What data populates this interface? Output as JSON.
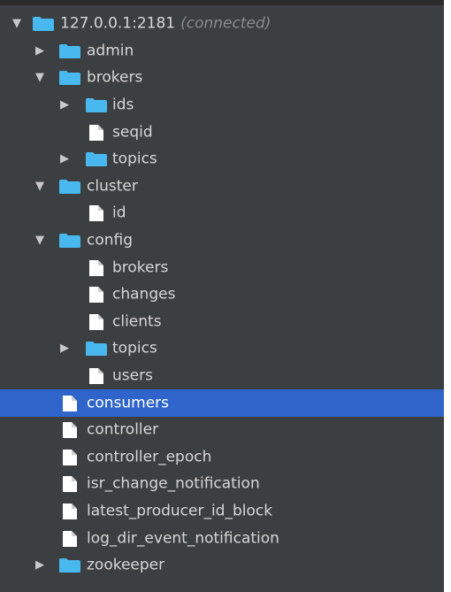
{
  "colors": {
    "background": "#3c3f41",
    "text": "#d6d6d6",
    "folder": "#49b8ef",
    "file": "#ffffff",
    "selection": "#2f65ca",
    "status": "#8a8a8a"
  },
  "tree": {
    "root": {
      "label": "127.0.0.1:2181",
      "status": "(connected)",
      "expanded": true,
      "icon": "folder-icon"
    },
    "nodes": [
      {
        "label": "admin",
        "type": "folder",
        "level": 1,
        "arrow": "collapsed"
      },
      {
        "label": "brokers",
        "type": "folder",
        "level": 1,
        "arrow": "expanded"
      },
      {
        "label": "ids",
        "type": "folder",
        "level": 2,
        "arrow": "collapsed"
      },
      {
        "label": "seqid",
        "type": "file",
        "level": 2,
        "arrow": "none"
      },
      {
        "label": "topics",
        "type": "folder",
        "level": 2,
        "arrow": "collapsed"
      },
      {
        "label": "cluster",
        "type": "folder",
        "level": 1,
        "arrow": "expanded"
      },
      {
        "label": "id",
        "type": "file",
        "level": 2,
        "arrow": "none"
      },
      {
        "label": "config",
        "type": "folder",
        "level": 1,
        "arrow": "expanded"
      },
      {
        "label": "brokers",
        "type": "file",
        "level": 2,
        "arrow": "none"
      },
      {
        "label": "changes",
        "type": "file",
        "level": 2,
        "arrow": "none"
      },
      {
        "label": "clients",
        "type": "file",
        "level": 2,
        "arrow": "none"
      },
      {
        "label": "topics",
        "type": "folder",
        "level": 2,
        "arrow": "collapsed"
      },
      {
        "label": "users",
        "type": "file",
        "level": 2,
        "arrow": "none"
      },
      {
        "label": "consumers",
        "type": "file",
        "level": 1,
        "arrow": "none",
        "selected": true
      },
      {
        "label": "controller",
        "type": "file",
        "level": 1,
        "arrow": "none"
      },
      {
        "label": "controller_epoch",
        "type": "file",
        "level": 1,
        "arrow": "none"
      },
      {
        "label": "isr_change_notification",
        "type": "file",
        "level": 1,
        "arrow": "none"
      },
      {
        "label": "latest_producer_id_block",
        "type": "file",
        "level": 1,
        "arrow": "none"
      },
      {
        "label": "log_dir_event_notification",
        "type": "file",
        "level": 1,
        "arrow": "none"
      },
      {
        "label": "zookeeper",
        "type": "folder",
        "level": 1,
        "arrow": "collapsed"
      }
    ]
  }
}
